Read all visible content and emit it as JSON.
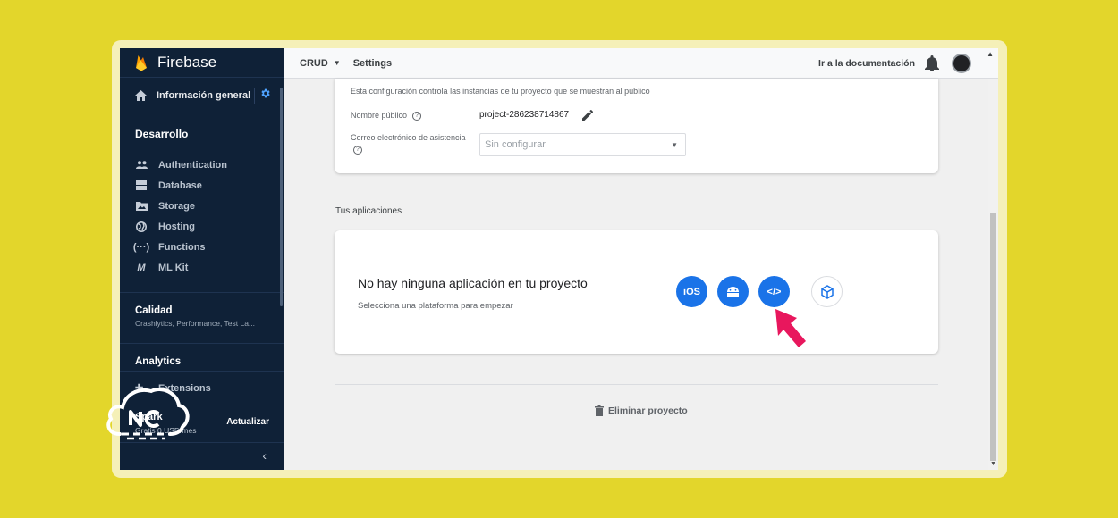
{
  "sidebar": {
    "brand": "Firebase",
    "overview_label": "Información general del proyecto",
    "develop_heading": "Desarrollo",
    "develop_items": [
      {
        "label": "Authentication",
        "icon": "people-icon"
      },
      {
        "label": "Database",
        "icon": "database-icon"
      },
      {
        "label": "Storage",
        "icon": "storage-icon"
      },
      {
        "label": "Hosting",
        "icon": "globe-icon"
      },
      {
        "label": "Functions",
        "icon": "functions-icon"
      },
      {
        "label": "ML Kit",
        "icon": "mlkit-icon"
      }
    ],
    "quality_heading": "Calidad",
    "quality_sub": "Crashlytics, Performance, Test La...",
    "analytics_heading": "Analytics",
    "extensions_label": "Extensions",
    "plan_name": "Spark",
    "plan_price": "Gratis 0 USD/mes",
    "upgrade_label": "Actualizar",
    "collapse_glyph": "‹"
  },
  "topbar": {
    "project": "CRUD",
    "page": "Settings",
    "docs_link": "Ir a la documentación"
  },
  "public_settings": {
    "description": "Esta configuración controla las instancias de tu proyecto que se muestran al público",
    "public_name_label": "Nombre público",
    "public_name_value": "project-286238714867",
    "support_email_label": "Correo electrónico de asistencia",
    "support_email_placeholder": "Sin configurar"
  },
  "apps": {
    "section_title": "Tus aplicaciones",
    "empty_title": "No hay ninguna aplicación en tu proyecto",
    "empty_subtitle": "Selecciona una plataforma para empezar",
    "platforms": [
      {
        "label": "iOS",
        "icon": "ios-icon"
      },
      {
        "label": "",
        "icon": "android-icon"
      },
      {
        "label": "</>",
        "icon": "web-code-icon"
      },
      {
        "label": "",
        "icon": "unity-icon"
      }
    ]
  },
  "delete_label": "Eliminar proyecto",
  "colors": {
    "page_bg": "#e3d62b",
    "sidebar_bg": "#0f2137",
    "accent_blue": "#1a73e8",
    "arrow": "#e8175d"
  }
}
